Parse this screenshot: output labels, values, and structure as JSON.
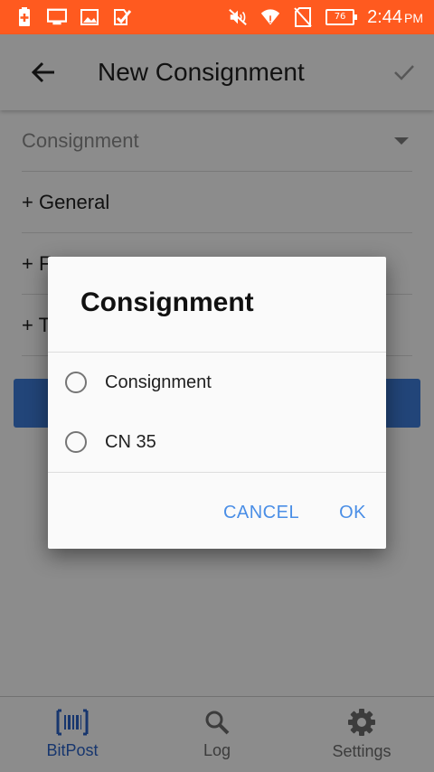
{
  "status_bar": {
    "time": "2:44",
    "ampm": "PM",
    "battery": "76",
    "icons": [
      "battery-saver-icon",
      "monitor-icon",
      "image-icon",
      "checklist-icon",
      "mute-icon",
      "wifi-icon",
      "no-sim-icon",
      "battery-icon"
    ]
  },
  "app_bar": {
    "title": "New Consignment",
    "back_icon": "arrow-back-icon",
    "confirm_icon": "check-icon"
  },
  "form": {
    "select_value": "Consignment",
    "sections": [
      {
        "label": "+ General"
      },
      {
        "label": "+ F"
      },
      {
        "label": "+ T"
      }
    ]
  },
  "dialog": {
    "title": "Consignment",
    "options": [
      {
        "label": "Consignment",
        "selected": false
      },
      {
        "label": "CN 35",
        "selected": false
      }
    ],
    "cancel_label": "CANCEL",
    "ok_label": "OK"
  },
  "bottom_nav": {
    "items": [
      {
        "label": "BitPost",
        "icon": "barcode-icon",
        "active": true
      },
      {
        "label": "Log",
        "icon": "search-icon",
        "active": false
      },
      {
        "label": "Settings",
        "icon": "gear-icon",
        "active": false
      }
    ]
  },
  "colors": {
    "status_bar": "#ff5a1f",
    "accent_blue": "#2a63c9",
    "dialog_button": "#4a8ee6"
  }
}
